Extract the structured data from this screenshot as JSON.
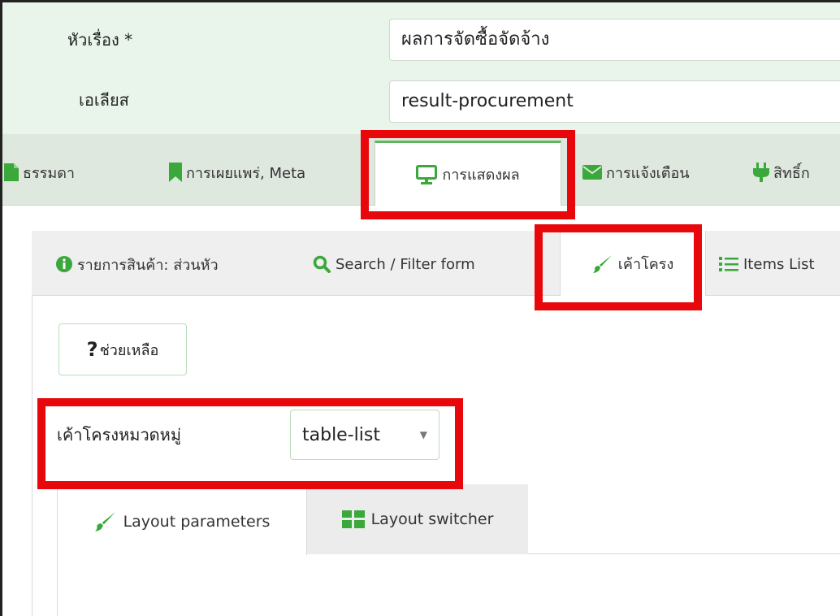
{
  "form": {
    "title_label": "หัวเรื่อง *",
    "title_value": "ผลการจัดซื้อจัดจ้าง",
    "alias_label": "เอเลียส",
    "alias_value": "result-procurement"
  },
  "main_tabs": [
    {
      "label": "ธรรมดา",
      "icon": "file-icon",
      "active": false
    },
    {
      "label": "การเผยแพร่, Meta",
      "icon": "bookmark-icon",
      "active": false
    },
    {
      "label": "การแสดงผล",
      "icon": "monitor-icon",
      "active": true
    },
    {
      "label": "การแจ้งเตือน",
      "icon": "envelope-icon",
      "active": false
    },
    {
      "label": "สิทธิ์ก",
      "icon": "plug-icon",
      "active": false
    }
  ],
  "sub_tabs": [
    {
      "label": "รายการสินค้า: ส่วนหัว",
      "icon": "info-icon",
      "active": false
    },
    {
      "label": "Search / Filter form",
      "icon": "search-icon",
      "active": false
    },
    {
      "label": "เค้าโครง",
      "icon": "brush-icon",
      "active": true
    },
    {
      "label": "Items List",
      "icon": "list-icon",
      "active": false
    }
  ],
  "help_button": {
    "symbol": "?",
    "label": "ช่วยเหลือ"
  },
  "category_layout": {
    "label": "เค้าโครงหมวดหมู่",
    "selected": "table-list"
  },
  "inner_tabs": [
    {
      "label": "Layout parameters",
      "icon": "brush-icon",
      "active": true
    },
    {
      "label": "Layout switcher",
      "icon": "grid-icon",
      "active": false
    }
  ],
  "colors": {
    "accent_green": "#5cb85c",
    "highlight_red": "#e8080c",
    "icon_green": "#3aa83a",
    "icon_blue": "#1a73c9"
  }
}
